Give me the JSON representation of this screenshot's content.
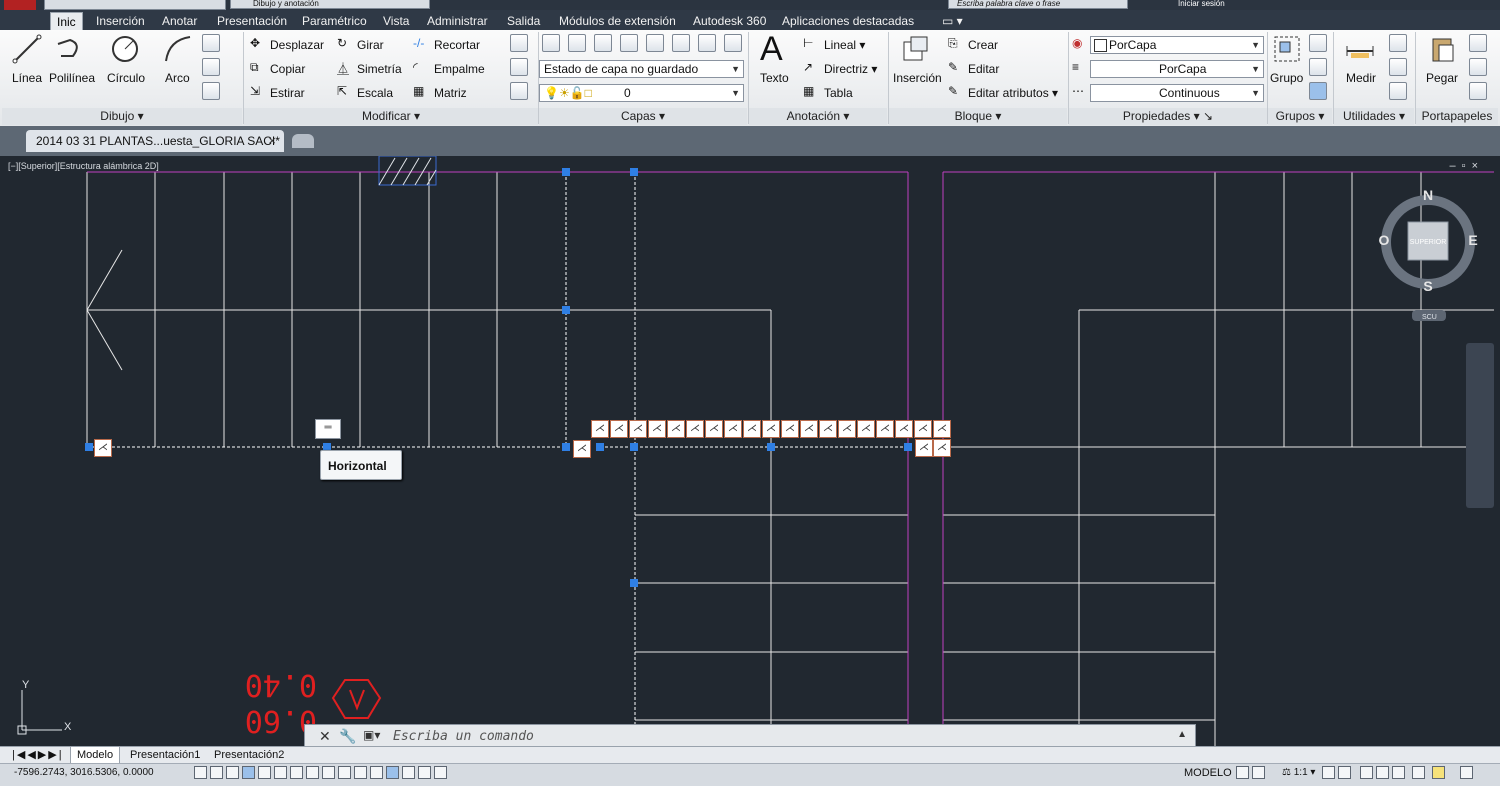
{
  "title_strip": {
    "workspace": "Dibujo y anotación",
    "search_placeholder": "Escriba palabra clave o frase",
    "signin": "Iniciar sesión"
  },
  "tabs": [
    "Inic",
    "Inserción",
    "Anotar",
    "Presentación",
    "Paramétrico",
    "Vista",
    "Administrar",
    "Salida",
    "Módulos de extensión",
    "Autodesk 360",
    "Aplicaciones destacadas"
  ],
  "ribbon": {
    "dibujo": {
      "title": "Dibujo",
      "tools": [
        "Línea",
        "Polilínea",
        "Círculo",
        "Arco"
      ]
    },
    "modificar": {
      "title": "Modificar",
      "tools": [
        "Desplazar",
        "Girar",
        "Recortar",
        "Copiar",
        "Simetría",
        "Empalme",
        "Estirar",
        "Escala",
        "Matriz"
      ]
    },
    "capas": {
      "title": "Capas",
      "layer_state": "Estado de capa no guardado",
      "current_layer": "0"
    },
    "anotacion": {
      "title": "Anotación",
      "texto": "Texto",
      "tools": [
        "Lineal",
        "Directriz",
        "Tabla"
      ]
    },
    "bloque": {
      "title": "Bloque",
      "insercion": "Inserción",
      "tools": [
        "Crear",
        "Editar",
        "Editar atributos"
      ]
    },
    "propiedades": {
      "title": "Propiedades",
      "color": "PorCapa",
      "lineweight": "PorCapa",
      "linetype": "Continuous"
    },
    "grupos": {
      "title": "Grupos",
      "grupo": "Grupo"
    },
    "utilidades": {
      "title": "Utilidades",
      "medir": "Medir"
    },
    "portapapeles": {
      "title": "Portapapeles",
      "pegar": "Pegar"
    }
  },
  "document_tab": "2014 03 31 PLANTAS...uesta_GLORIA SACI*",
  "viewport": {
    "label": "[−][Superior][Estructura alámbrica 2D]",
    "viewcube": {
      "n": "N",
      "s": "S",
      "e": "E",
      "w": "O",
      "face": "SUPERIOR",
      "ucs": "SCU"
    },
    "tooltip": "Horizontal",
    "red_text": [
      "0.40",
      "0.60"
    ],
    "axis_labels": {
      "x": "X",
      "y": "Y"
    }
  },
  "command_line": {
    "placeholder": "Escriba un comando"
  },
  "layout_tabs": [
    "Modelo",
    "Presentación1",
    "Presentación2"
  ],
  "status": {
    "coords": "-7596.2743, 3016.5306, 0.0000",
    "mode": "MODELO",
    "scale": "1:1"
  },
  "colors": {
    "accent_blue": "#2f7fe4",
    "magenta": "#c040c0",
    "red": "#e02020",
    "bg": "#212830"
  }
}
